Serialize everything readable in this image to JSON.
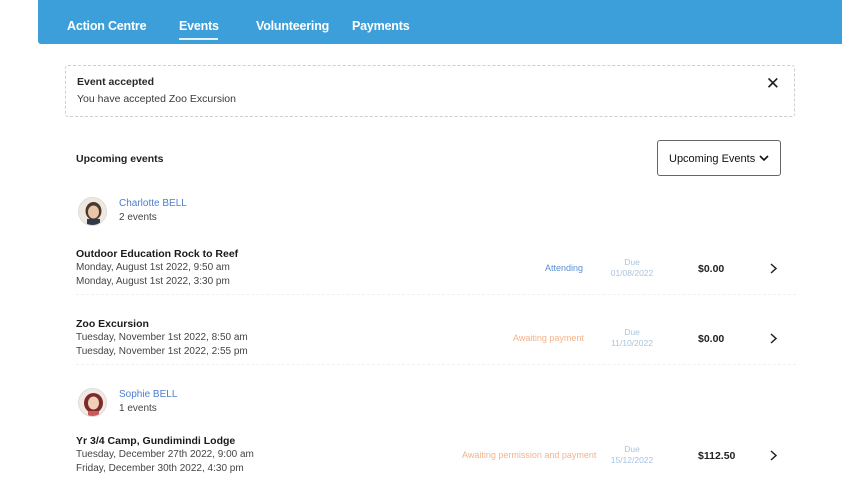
{
  "nav": {
    "items": [
      "Action Centre",
      "Events",
      "Volunteering",
      "Payments"
    ],
    "active": "Events"
  },
  "alert": {
    "title": "Event accepted",
    "message": "You have accepted Zoo Excursion",
    "close_icon": "close-icon"
  },
  "upcoming": {
    "title": "Upcoming events",
    "filter_label": "Upcoming Events"
  },
  "students": [
    {
      "name": "Charlotte BELL",
      "count": "2 events",
      "events": [
        {
          "title": "Outdoor Education Rock to Reef",
          "start": "Monday, August 1st 2022, 9:50 am",
          "end": "Monday, August 1st 2022, 3:30 pm",
          "status": "Attending",
          "date_top": "Due",
          "date_bottom": "01/08/2022",
          "price": "$0.00"
        },
        {
          "title": "Zoo Excursion",
          "start": "Tuesday, November 1st 2022, 8:50 am",
          "end": "Tuesday, November 1st 2022, 2:55 pm",
          "status": "Awaiting payment",
          "date_top": "Due",
          "date_bottom": "11/10/2022",
          "price": "$0.00"
        }
      ]
    },
    {
      "name": "Sophie BELL",
      "count": "1 events",
      "events": [
        {
          "title": "Yr 3/4 Camp, Gundimindi Lodge",
          "start": "Tuesday, December 27th 2022, 9:00 am",
          "end": "Friday, December 30th 2022, 4:30 pm",
          "status": "Awaiting permission and payment",
          "date_top": "Due",
          "date_bottom": "15/12/2022",
          "price": "$112.50"
        }
      ]
    }
  ],
  "colors": {
    "nav_bg": "#3d9fd9",
    "link_blue": "#4b7fd0",
    "status_attending": "#5b8fd6",
    "status_awaiting": "#f3b38a"
  }
}
